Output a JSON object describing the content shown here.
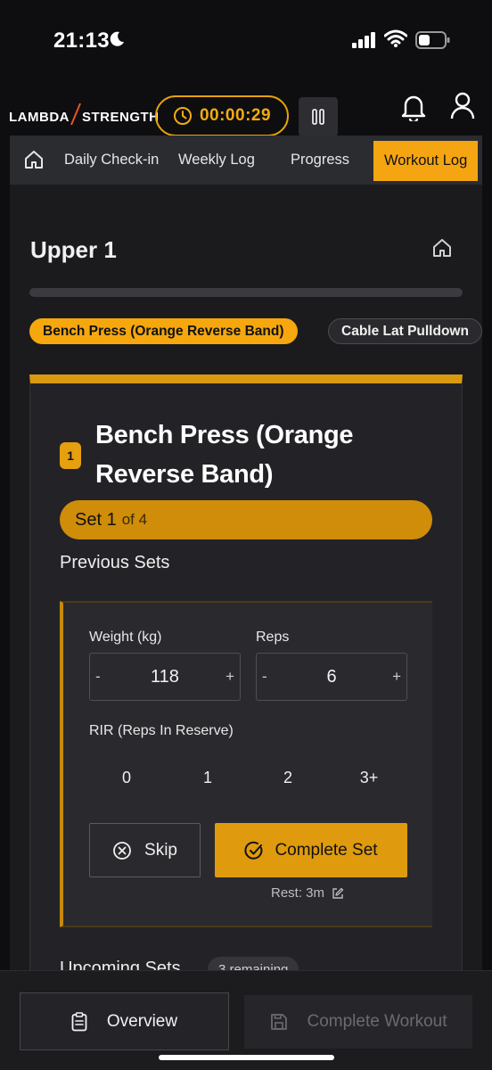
{
  "status_bar": {
    "time": "21:13",
    "icons": [
      "moon-icon",
      "signal-icon",
      "wifi-icon",
      "battery-icon"
    ]
  },
  "header": {
    "logo_left": "LAMBDA",
    "logo_right": "STRENGTH",
    "timer": "00:00:29",
    "accent": "#f5a511"
  },
  "nav": {
    "items": [
      "Daily Check-in",
      "Weekly Log",
      "Progress",
      "Workout Log"
    ],
    "active": "Workout Log"
  },
  "workout": {
    "title": "Upper 1",
    "progress": 0,
    "exercise_chips": [
      "Bench Press (Orange Reverse Band)",
      "Cable Lat Pulldown"
    ]
  },
  "exercise": {
    "index": "1",
    "name": "Bench Press (Orange Reverse Band)",
    "set_label": "Set 1",
    "set_of": "of 4",
    "previous_sets_label": "Previous Sets",
    "weight_label": "Weight (kg)",
    "weight_value": "118",
    "reps_label": "Reps",
    "reps_value": "6",
    "minus": "-",
    "plus": "+",
    "rir_label": "RIR (Reps In Reserve)",
    "rir_options": [
      "0",
      "1",
      "2",
      "3+"
    ],
    "skip_label": "Skip",
    "complete_label": "Complete Set",
    "rest_label": "Rest: 3m",
    "upcoming_label": "Upcoming Sets",
    "remaining_badge": "3 remaining"
  },
  "bottom": {
    "overview_label": "Overview",
    "finish_label": "Complete Workout"
  }
}
